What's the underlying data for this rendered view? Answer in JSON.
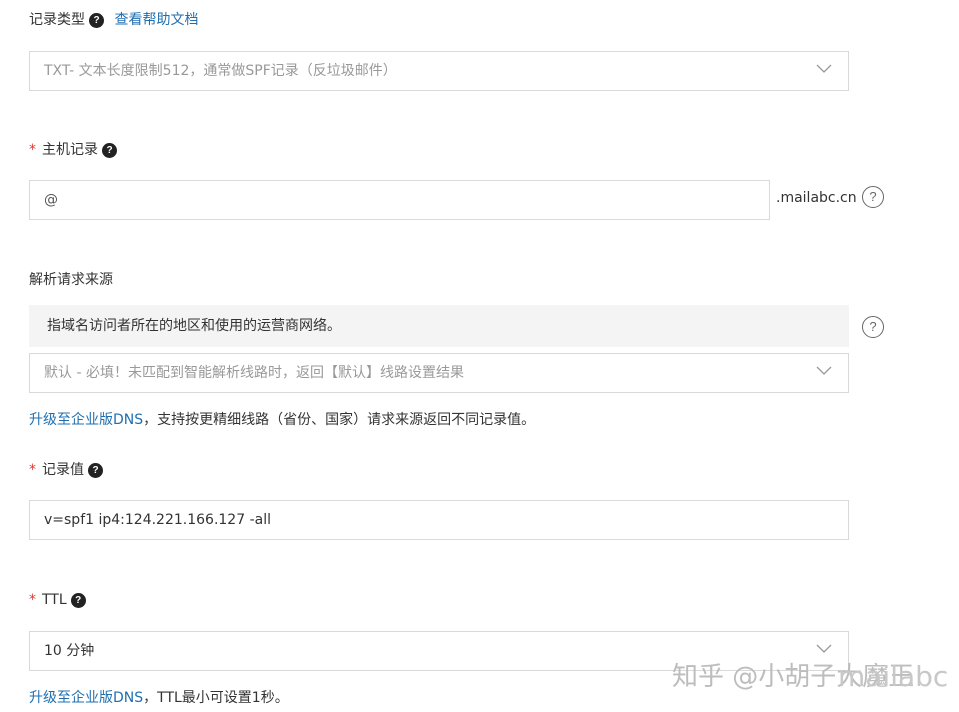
{
  "record_type": {
    "label": "记录类型",
    "help_link": "查看帮助文档",
    "selected": "TXT- 文本长度限制512，通常做SPF记录（反垃圾邮件）"
  },
  "host_record": {
    "required_mark": "*",
    "label": "主机记录",
    "value": "@",
    "suffix": ".mailabc.cn"
  },
  "resolve_source": {
    "label": "解析请求来源",
    "info": "指域名访问者所在的地区和使用的运营商网络。",
    "selected": "默认 - 必填！未匹配到智能解析线路时，返回【默认】线路设置结果",
    "upgrade_link": "升级至企业版DNS",
    "upgrade_text": "，支持按更精细线路（省份、国家）请求来源返回不同记录值。"
  },
  "record_value": {
    "required_mark": "*",
    "label": "记录值",
    "value": "v=spf1 ip4:124.221.166.127 -all"
  },
  "ttl": {
    "required_mark": "*",
    "label": "TTL",
    "selected": "10 分钟",
    "upgrade_link": "升级至企业版DNS",
    "upgrade_text": "，TTL最小可设置1秒。"
  },
  "watermark": "知乎 @小胡子大魔王",
  "watermark_tail": "mailabc"
}
